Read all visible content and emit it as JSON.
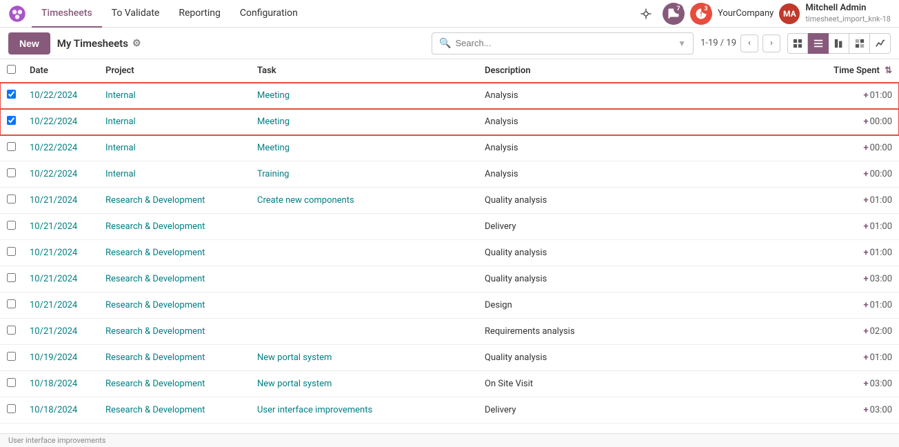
{
  "app": {
    "logo_alt": "Odoo",
    "title": "Timesheets"
  },
  "topbar": {
    "nav_items": [
      {
        "label": "Timesheets",
        "active": true
      },
      {
        "label": "To Validate",
        "active": false
      },
      {
        "label": "Reporting",
        "active": false
      },
      {
        "label": "Configuration",
        "active": false
      }
    ],
    "bug_icon": "🐛",
    "chat_badge": "7",
    "activity_badge": "3",
    "company": "YourCompany",
    "user_name": "Mitchell Admin",
    "user_sub": "timesheet_import_knk-18",
    "user_initials": "MA"
  },
  "secondbar": {
    "new_btn": "New",
    "page_title": "My Timesheets",
    "search_placeholder": "Search...",
    "pagination": "1-19 / 19"
  },
  "table": {
    "headers": [
      "",
      "Date",
      "Project",
      "Task",
      "Description",
      "Time Spent"
    ],
    "rows": [
      {
        "selected": true,
        "date": "10/22/2024",
        "project": "Internal",
        "task": "Meeting",
        "description": "Analysis",
        "time": "01:00"
      },
      {
        "selected": true,
        "date": "10/22/2024",
        "project": "Internal",
        "task": "Meeting",
        "description": "Analysis",
        "time": "00:00"
      },
      {
        "selected": false,
        "date": "10/22/2024",
        "project": "Internal",
        "task": "Meeting",
        "description": "Analysis",
        "time": "00:00"
      },
      {
        "selected": false,
        "date": "10/22/2024",
        "project": "Internal",
        "task": "Training",
        "description": "Analysis",
        "time": "00:00"
      },
      {
        "selected": false,
        "date": "10/21/2024",
        "project": "Research & Development",
        "task": "Create new components",
        "description": "Quality analysis",
        "time": "01:00"
      },
      {
        "selected": false,
        "date": "10/21/2024",
        "project": "Research & Development",
        "task": "",
        "description": "Delivery",
        "time": "01:00"
      },
      {
        "selected": false,
        "date": "10/21/2024",
        "project": "Research & Development",
        "task": "",
        "description": "Quality analysis",
        "time": "01:00"
      },
      {
        "selected": false,
        "date": "10/21/2024",
        "project": "Research & Development",
        "task": "",
        "description": "Quality analysis",
        "time": "03:00"
      },
      {
        "selected": false,
        "date": "10/21/2024",
        "project": "Research & Development",
        "task": "",
        "description": "Design",
        "time": "01:00"
      },
      {
        "selected": false,
        "date": "10/21/2024",
        "project": "Research & Development",
        "task": "",
        "description": "Requirements analysis",
        "time": "02:00"
      },
      {
        "selected": false,
        "date": "10/19/2024",
        "project": "Research & Development",
        "task": "New portal system",
        "description": "Quality analysis",
        "time": "01:00"
      },
      {
        "selected": false,
        "date": "10/18/2024",
        "project": "Research & Development",
        "task": "New portal system",
        "description": "On Site Visit",
        "time": "03:00"
      },
      {
        "selected": false,
        "date": "10/18/2024",
        "project": "Research & Development",
        "task": "User interface improvements",
        "description": "Delivery",
        "time": "03:00"
      }
    ]
  },
  "footer": {
    "hint": "User interface improvements"
  }
}
